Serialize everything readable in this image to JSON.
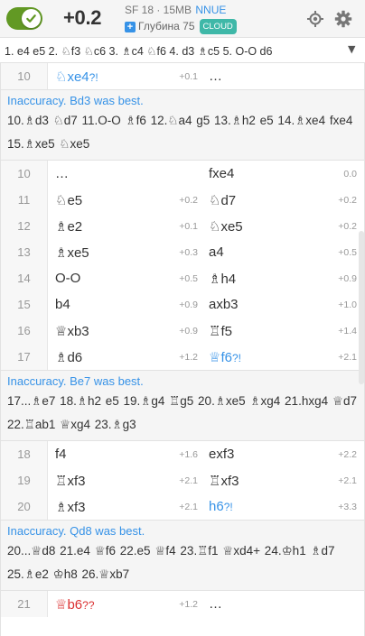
{
  "ceval": {
    "toggle_state": "on",
    "eval": "+0.2",
    "engine_name": "SF 18 · 15MB",
    "engine_tag": "NNUE",
    "depth_plus": "+",
    "depth_label": "Глубина 75",
    "cloud_badge": "CLOUD"
  },
  "pv": {
    "line": "1. e4 e5 2. ♘f3 ♘c6 3. ♗c4 ♘f6 4. d3 ♗c5 5. O-O d6",
    "toggle_glyph": "▼"
  },
  "rows": [
    {
      "num": "10",
      "white": "♘xe4",
      "white_glyph": "?!",
      "white_class": "inacc",
      "white_eval": "+0.1",
      "black": "…",
      "black_eval": ""
    }
  ],
  "interrupt1": {
    "comment": "Inaccuracy. Bd3 was best.",
    "variation": "10.♗d3 ♘d7 11.O-O ♗f6 12.♘a4 g5 13.♗h2 e5 14.♗xe4 fxe4 15.♗xe5 ♘xe5"
  },
  "rows2": [
    {
      "num": "10",
      "white": "…",
      "white_eval": "",
      "black": "fxe4",
      "black_eval": "0.0"
    },
    {
      "num": "11",
      "white": "♘e5",
      "white_eval": "+0.2",
      "black": "♘d7",
      "black_eval": "+0.2"
    },
    {
      "num": "12",
      "white": "♗e2",
      "white_eval": "+0.1",
      "black": "♘xe5",
      "black_eval": "+0.2"
    },
    {
      "num": "13",
      "white": "♗xe5",
      "white_eval": "+0.3",
      "black": "a4",
      "black_eval": "+0.5"
    },
    {
      "num": "14",
      "white": "O-O",
      "white_eval": "+0.5",
      "black": "♗h4",
      "black_eval": "+0.9"
    },
    {
      "num": "15",
      "white": "b4",
      "white_eval": "+0.9",
      "black": "axb3",
      "black_eval": "+1.0"
    },
    {
      "num": "16",
      "white": "♕xb3",
      "white_eval": "+0.9",
      "black": "♖f5",
      "black_eval": "+1.4"
    },
    {
      "num": "17",
      "white": "♗d6",
      "white_eval": "+1.2",
      "black": "♕f6",
      "black_glyph": "?!",
      "black_class": "inacc",
      "black_eval": "+2.1"
    }
  ],
  "interrupt2": {
    "comment": "Inaccuracy. Be7 was best.",
    "variation": "17...♗e7 18.♗h2 e5 19.♗g4 ♖g5 20.♗xe5 ♗xg4 21.hxg4 ♕d7 22.♖ab1 ♕xg4 23.♗g3"
  },
  "rows3": [
    {
      "num": "18",
      "white": "f4",
      "white_eval": "+1.6",
      "black": "exf3",
      "black_eval": "+2.2"
    },
    {
      "num": "19",
      "white": "♖xf3",
      "white_eval": "+2.1",
      "black": "♖xf3",
      "black_eval": "+2.1"
    },
    {
      "num": "20",
      "white": "♗xf3",
      "white_eval": "+2.1",
      "black": "h6",
      "black_glyph": "?!",
      "black_class": "inacc",
      "black_eval": "+3.3"
    }
  ],
  "interrupt3": {
    "comment": "Inaccuracy. Qd8 was best.",
    "variation": "20...♕d8 21.e4 ♕f6 22.e5 ♕f4 23.♖f1 ♕xd4+ 24.♔h1 ♗d7 25.♗e2 ♔h8 26.♕xb7"
  },
  "rows4": [
    {
      "num": "21",
      "white": "♕b6",
      "white_glyph": "??",
      "white_class": "blunder",
      "white_eval": "+1.2",
      "black": "…",
      "black_eval": ""
    }
  ],
  "colors": {
    "toggle": "#629924",
    "inaccuracy": "#3692e7",
    "blunder": "#db3031",
    "cloud": "#3fb8a8"
  },
  "icons": {
    "toggle": "check-icon",
    "target": "target-icon",
    "settings": "gear-icon",
    "depth": "plus-icon",
    "pv_toggle": "triangle-down-icon"
  }
}
